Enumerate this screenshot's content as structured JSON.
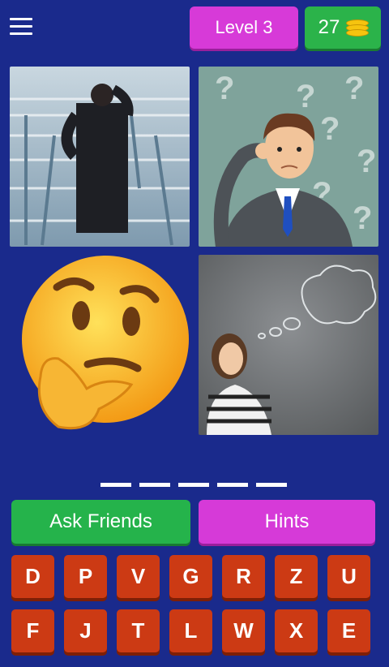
{
  "header": {
    "level_label": "Level 3",
    "coins": "27"
  },
  "images": [
    {
      "icon": "man-in-maze"
    },
    {
      "icon": "confused-man-with-question-marks"
    },
    {
      "icon": "thinking-face-emoji"
    },
    {
      "icon": "woman-thinking-chalk-cloud"
    }
  ],
  "answer_slots": 5,
  "buttons": {
    "ask_friends": "Ask Friends",
    "hints": "Hints"
  },
  "letters": {
    "row1": [
      "D",
      "P",
      "V",
      "G",
      "R",
      "Z",
      "U"
    ],
    "row2": [
      "F",
      "J",
      "T",
      "L",
      "W",
      "X",
      "E"
    ]
  },
  "colors": {
    "background": "#1a2a8c",
    "level_badge": "#d73ad8",
    "coins_badge": "#2bb34a",
    "ask_friends": "#25b34b",
    "hints": "#d63ad8",
    "letter_key": "#cc3a14"
  }
}
